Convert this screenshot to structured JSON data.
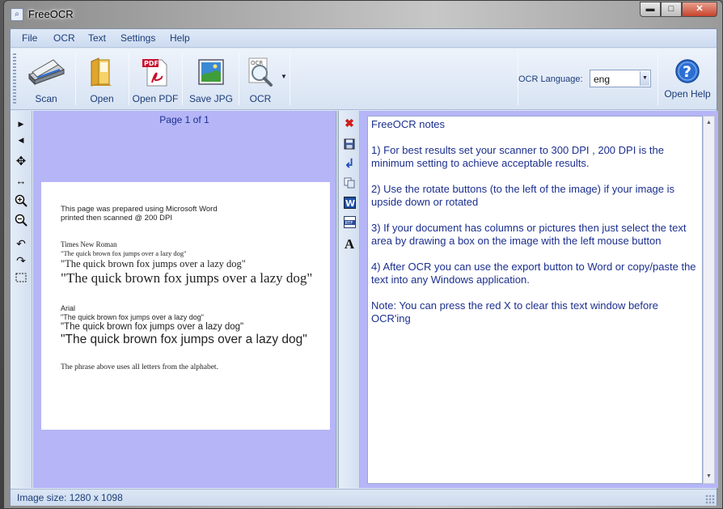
{
  "window": {
    "title": "FreeOCR",
    "minimize": "▬",
    "maximize": "□",
    "close": "✕"
  },
  "menu": [
    "File",
    "OCR",
    "Text",
    "Settings",
    "Help"
  ],
  "toolbar": {
    "scan": "Scan",
    "open": "Open",
    "open_pdf": "Open PDF",
    "save_jpg": "Save JPG",
    "ocr": "OCR",
    "ocr_language_label": "OCR Language:",
    "ocr_language_value": "eng",
    "open_help": "Open Help"
  },
  "image_pane": {
    "page_label": "Page 1 of 1",
    "document_lines": [
      "This page was prepared using Microsoft Word",
      "printed then scanned @ 200 DPI",
      "Times New Roman",
      "\"The quick brown fox jumps over a lazy dog\"",
      "\"The quick brown fox jumps over a lazy dog\"",
      "\"The quick brown fox jumps over a lazy dog\"",
      "Arial",
      "\"The quick brown fox jumps over a lazy dog\"",
      "\"The quick brown fox  jumps over a lazy dog\"",
      "\"The quick brown fox jumps over a lazy dog\"",
      "The phrase above uses all letters from the alphabet."
    ]
  },
  "text_pane": {
    "paragraphs": [
      "FreeOCR notes",
      "1) For best results set your scanner to 300 DPI , 200 DPI is the minimum setting to achieve acceptable results.",
      "2) Use the rotate buttons (to the left of the image) if your image is upside down or rotated",
      "3) If your document has columns or pictures then just select the text area by drawing a box on the image with the left mouse button",
      "4) After OCR you can use the export button to Word or copy/paste the text into any Windows application.",
      "Note: You can press the red X to clear this text window before OCR'ing"
    ]
  },
  "status": {
    "image_size": "Image size:  1280 x 1098"
  }
}
